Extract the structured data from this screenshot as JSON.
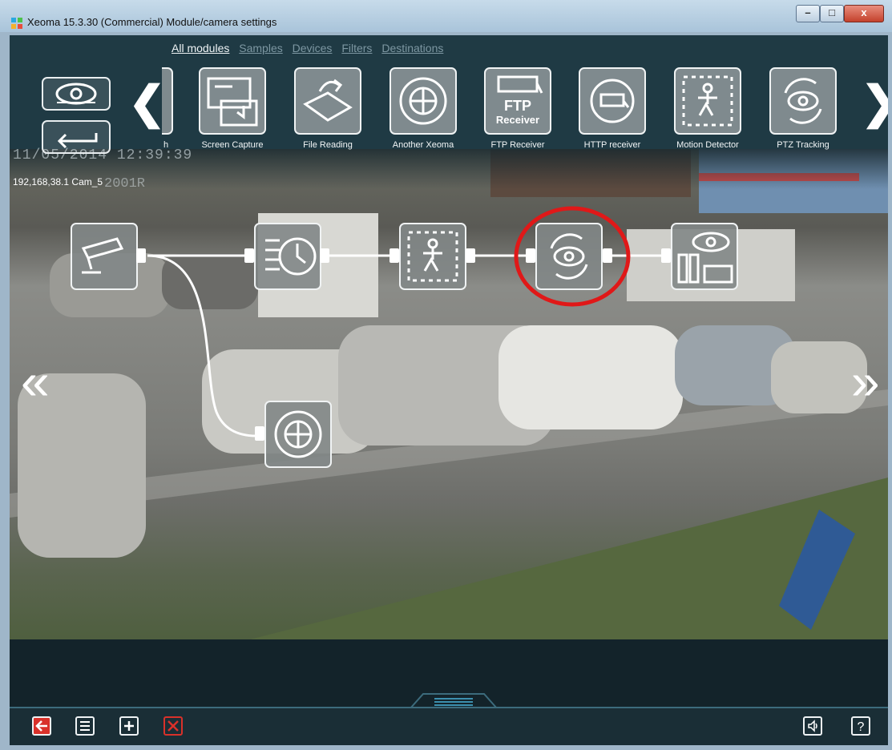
{
  "window": {
    "title": "Xeoma 15.3.30 (Commercial) Module/camera settings",
    "controls": {
      "minimize": "–",
      "maximize": "□",
      "close": "x"
    }
  },
  "categories": [
    "All modules",
    "Samples",
    "Devices",
    "Filters",
    "Destinations"
  ],
  "active_category": "All modules",
  "module_palette": [
    {
      "label": "h",
      "icon": "partial-module-icon"
    },
    {
      "label": "Screen Capture",
      "icon": "screen-capture-icon"
    },
    {
      "label": "File Reading",
      "icon": "file-reading-icon"
    },
    {
      "label": "Another Xeoma",
      "icon": "another-xeoma-icon"
    },
    {
      "label": "FTP Receiver",
      "icon": "ftp-receiver-icon",
      "icon_text": [
        "FTP",
        "Receiver"
      ]
    },
    {
      "label": "HTTP receiver",
      "icon": "http-receiver-icon"
    },
    {
      "label": "Motion Detector",
      "icon": "motion-detector-icon"
    },
    {
      "label": "PTZ Tracking",
      "icon": "ptz-tracking-icon"
    }
  ],
  "camera": {
    "osd_datetime": "11/05/2014 12:39:39",
    "osd_model": "2001R",
    "name": "192,168,38.1 Cam_5"
  },
  "pipeline": [
    {
      "name": "camera",
      "icon": "camera-icon"
    },
    {
      "name": "scheduler",
      "icon": "scheduler-icon"
    },
    {
      "name": "motion-detector",
      "icon": "motion-detector-icon"
    },
    {
      "name": "ptz-tracking",
      "icon": "ptz-tracking-icon",
      "highlighted": true
    },
    {
      "name": "preview-archive",
      "icon": "preview-archive-icon"
    },
    {
      "name": "another-xeoma",
      "icon": "another-xeoma-icon"
    }
  ],
  "colors": {
    "highlight": "#e01818",
    "accent": "#3c6b7c",
    "danger": "#d9312a"
  }
}
